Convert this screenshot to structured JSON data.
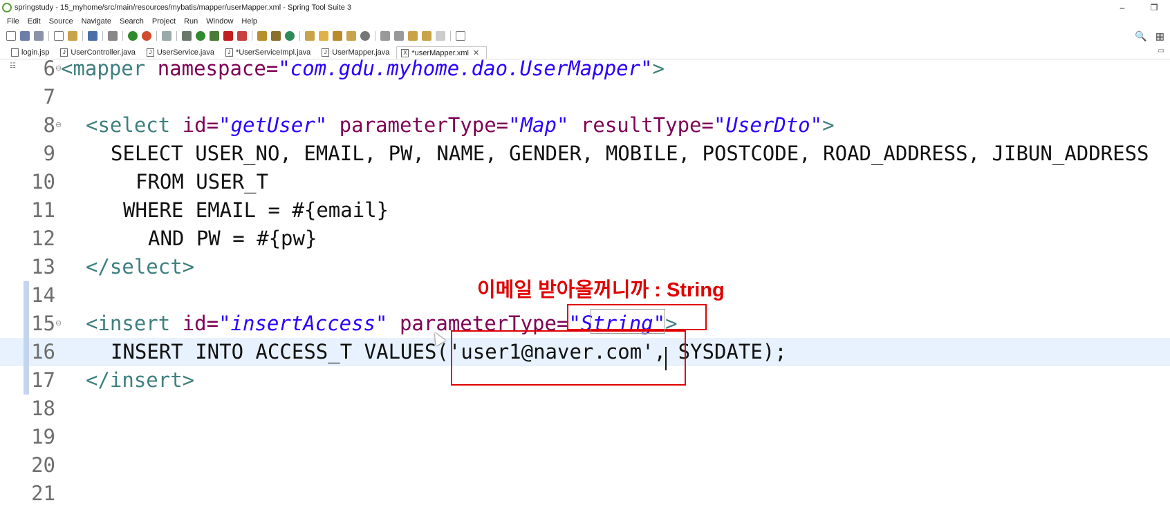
{
  "window": {
    "title": "springstudy - 15_myhome/src/main/resources/mybatis/mapper/userMapper.xml - Spring Tool Suite 3",
    "minimize": "–",
    "restore": "❐"
  },
  "menu": [
    "File",
    "Edit",
    "Source",
    "Navigate",
    "Search",
    "Project",
    "Run",
    "Window",
    "Help"
  ],
  "tabs": [
    {
      "label": "login.jsp",
      "icon": "jsp-file-icon"
    },
    {
      "label": "UserController.java",
      "icon": "java-file-icon"
    },
    {
      "label": "UserService.java",
      "icon": "java-file-icon"
    },
    {
      "label": "*UserServiceImpl.java",
      "icon": "java-file-icon"
    },
    {
      "label": "UserMapper.java",
      "icon": "java-file-icon"
    },
    {
      "label": "*userMapper.xml",
      "icon": "xml-file-icon",
      "active": true
    }
  ],
  "editor": {
    "lines": [
      {
        "num": "6",
        "fold": "⊖"
      },
      {
        "num": "7"
      },
      {
        "num": "8",
        "fold": "⊖"
      },
      {
        "num": "9"
      },
      {
        "num": "10"
      },
      {
        "num": "11"
      },
      {
        "num": "12"
      },
      {
        "num": "13"
      },
      {
        "num": "14",
        "marked": true
      },
      {
        "num": "15",
        "fold": "⊖",
        "marked": true
      },
      {
        "num": "16",
        "marked": true,
        "highlighted": true
      },
      {
        "num": "17",
        "marked": true
      },
      {
        "num": "18"
      },
      {
        "num": "19"
      },
      {
        "num": "20"
      },
      {
        "num": "21"
      }
    ],
    "code": {
      "l6": {
        "open": "<mapper ",
        "attr": "namespace=",
        "val": "\"com.gdu.myhome.dao.UserMapper\"",
        "close": ">"
      },
      "l8": {
        "open": "<select ",
        "a1": "id=",
        "v1": "\"getUser\"",
        "a2": " parameterType=",
        "v2": "\"Map\"",
        "a3": " resultType=",
        "v3": "\"UserDto\"",
        "close": ">"
      },
      "l9": "SELECT USER_NO, EMAIL, PW, NAME, GENDER, MOBILE, POSTCODE, ROAD_ADDRESS, JIBUN_ADDRESS",
      "l10": "FROM USER_T",
      "l11": "WHERE EMAIL = #{email}",
      "l12": "AND PW = #{pw}",
      "l13": "</select>",
      "l15": {
        "open": "<insert ",
        "a1": "id=",
        "v1": "\"insertAccess\"",
        "a2": " parameterType=",
        "v2": "\"String\"",
        "close": ">"
      },
      "l16": "INSERT INTO ACCESS_T VALUES('user1@naver.com', SYSDATE);",
      "l17": "</insert>"
    }
  },
  "annotation": {
    "text": "이메일 받아올꺼니까 : String",
    "color": "#e00000"
  }
}
